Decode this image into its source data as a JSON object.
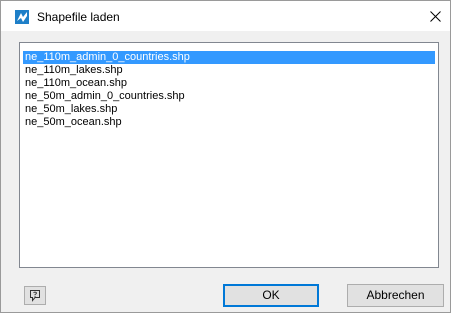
{
  "window": {
    "title": "Shapefile laden",
    "icon": "map-layer-icon",
    "close_icon": "close-icon"
  },
  "file_list": {
    "selected_index": 0,
    "items": [
      "ne_110m_admin_0_countries.shp",
      "ne_110m_lakes.shp",
      "ne_110m_ocean.shp",
      "ne_50m_admin_0_countries.shp",
      "ne_50m_lakes.shp",
      "ne_50m_ocean.shp"
    ]
  },
  "buttons": {
    "help_icon": "help-icon",
    "ok": "OK",
    "cancel": "Abbrechen"
  },
  "colors": {
    "selection": "#3399ff",
    "accent": "#0078d7",
    "icon_blue": "#1e7fc8"
  }
}
